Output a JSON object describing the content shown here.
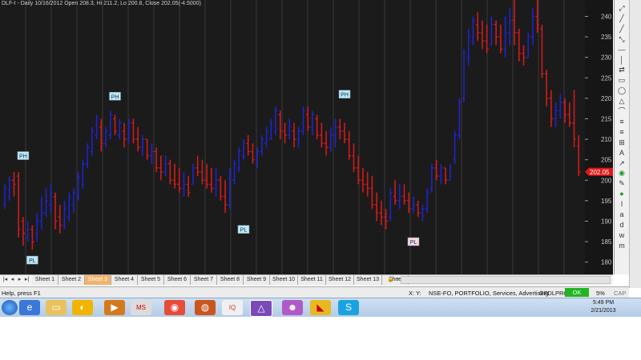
{
  "chart": {
    "title": "DLF-I - Daily 10/16/2012 Open 208.3, Hi 211.2, Lo 200.8, Close 202.05(-4.5000)",
    "last_price_label": "202.05",
    "y_ticks": [
      "240",
      "235",
      "230",
      "225",
      "220",
      "215",
      "210",
      "205",
      "200",
      "195",
      "190",
      "185",
      "180"
    ],
    "annotations": [
      {
        "text": "PH",
        "x": 4,
        "price": 206,
        "kind": "high"
      },
      {
        "text": "PL",
        "x": 6,
        "price": 180.5,
        "kind": "low"
      },
      {
        "text": "PH",
        "x": 24,
        "price": 220.5,
        "kind": "high"
      },
      {
        "text": "PL",
        "x": 52,
        "price": 188,
        "kind": "low"
      },
      {
        "text": "PH",
        "x": 74,
        "price": 221,
        "kind": "high"
      },
      {
        "text": "PL",
        "x": 89,
        "price": 185,
        "kind": "low"
      }
    ],
    "colors": {
      "up": "#1f24c8",
      "down": "#d11a1a",
      "neutral": "#f2e21a",
      "background": "#1b1b1b",
      "grid": "#3a3a3a"
    }
  },
  "chart_data": {
    "type": "ohlc",
    "title": "DLF-I - Daily 10/16/2012 Open 208.3, Hi 211.2, Lo 200.8, Close 202.05(-4.5000)",
    "ylim": [
      177,
      244
    ],
    "grid": true,
    "bars": [
      {
        "h": 199,
        "l": 193,
        "o": 194,
        "c": 198
      },
      {
        "h": 201,
        "l": 195,
        "o": 196,
        "c": 200
      },
      {
        "h": 202,
        "l": 196,
        "o": 200,
        "c": 199
      },
      {
        "h": 202,
        "l": 186,
        "o": 201,
        "c": 188
      },
      {
        "h": 191,
        "l": 184,
        "o": 190,
        "c": 187
      },
      {
        "h": 190,
        "l": 185,
        "o": 186,
        "c": 188
      },
      {
        "h": 189,
        "l": 183,
        "o": 188,
        "c": 185
      },
      {
        "h": 192,
        "l": 185,
        "o": 187,
        "c": 190
      },
      {
        "h": 196,
        "l": 188,
        "o": 190,
        "c": 192
      },
      {
        "h": 198,
        "l": 191,
        "o": 192,
        "c": 195
      },
      {
        "h": 199,
        "l": 192,
        "o": 194,
        "c": 197
      },
      {
        "h": 197,
        "l": 188,
        "o": 196,
        "c": 190
      },
      {
        "h": 194,
        "l": 187,
        "o": 191,
        "c": 189
      },
      {
        "h": 195,
        "l": 188,
        "o": 189,
        "c": 193
      },
      {
        "h": 197,
        "l": 190,
        "o": 191,
        "c": 196
      },
      {
        "h": 198,
        "l": 192,
        "o": 194,
        "c": 197
      },
      {
        "h": 202,
        "l": 195,
        "o": 196,
        "c": 201
      },
      {
        "h": 205,
        "l": 198,
        "o": 199,
        "c": 204
      },
      {
        "h": 209,
        "l": 203,
        "o": 204,
        "c": 208
      },
      {
        "h": 213,
        "l": 206,
        "o": 207,
        "c": 212
      },
      {
        "h": 216,
        "l": 210,
        "o": 211,
        "c": 215
      },
      {
        "h": 215,
        "l": 207,
        "o": 213,
        "c": 209
      },
      {
        "h": 213,
        "l": 208,
        "o": 209,
        "c": 212
      },
      {
        "h": 217,
        "l": 210,
        "o": 211,
        "c": 216
      },
      {
        "h": 216,
        "l": 211,
        "o": 215,
        "c": 212
      },
      {
        "h": 215,
        "l": 210,
        "o": 211,
        "c": 214
      },
      {
        "h": 214,
        "l": 208,
        "o": 212,
        "c": 210
      },
      {
        "h": 215,
        "l": 209,
        "o": 210,
        "c": 214
      },
      {
        "h": 215,
        "l": 209,
        "o": 214,
        "c": 210
      },
      {
        "h": 213,
        "l": 207,
        "o": 210,
        "c": 208
      },
      {
        "h": 211,
        "l": 206,
        "o": 208,
        "c": 210
      },
      {
        "h": 210,
        "l": 205,
        "o": 210,
        "c": 206
      },
      {
        "h": 209,
        "l": 204,
        "o": 206,
        "c": 207
      },
      {
        "h": 208,
        "l": 202,
        "o": 207,
        "c": 203
      },
      {
        "h": 206,
        "l": 200,
        "o": 203,
        "c": 202
      },
      {
        "h": 206,
        "l": 201,
        "o": 202,
        "c": 204
      },
      {
        "h": 205,
        "l": 199,
        "o": 204,
        "c": 200
      },
      {
        "h": 204,
        "l": 198,
        "o": 200,
        "c": 199
      },
      {
        "h": 203,
        "l": 197,
        "o": 199,
        "c": 198
      },
      {
        "h": 202,
        "l": 196,
        "o": 198,
        "c": 199
      },
      {
        "h": 201,
        "l": 196,
        "o": 199,
        "c": 197
      },
      {
        "h": 204,
        "l": 199,
        "o": 199,
        "c": 203
      },
      {
        "h": 206,
        "l": 201,
        "o": 203,
        "c": 202
      },
      {
        "h": 205,
        "l": 199,
        "o": 202,
        "c": 200
      },
      {
        "h": 204,
        "l": 198,
        "o": 200,
        "c": 199
      },
      {
        "h": 203,
        "l": 197,
        "o": 199,
        "c": 198
      },
      {
        "h": 203,
        "l": 196,
        "o": 198,
        "c": 200
      },
      {
        "h": 201,
        "l": 195,
        "o": 200,
        "c": 196
      },
      {
        "h": 200,
        "l": 192,
        "o": 196,
        "c": 194
      },
      {
        "h": 203,
        "l": 193,
        "o": 194,
        "c": 202
      },
      {
        "h": 205,
        "l": 199,
        "o": 200,
        "c": 204
      },
      {
        "h": 208,
        "l": 202,
        "o": 203,
        "c": 207
      },
      {
        "h": 210,
        "l": 205,
        "o": 206,
        "c": 209
      },
      {
        "h": 211,
        "l": 206,
        "o": 209,
        "c": 207
      },
      {
        "h": 209,
        "l": 204,
        "o": 207,
        "c": 205
      },
      {
        "h": 208,
        "l": 203,
        "o": 204,
        "c": 207
      },
      {
        "h": 211,
        "l": 206,
        "o": 207,
        "c": 210
      },
      {
        "h": 213,
        "l": 208,
        "o": 209,
        "c": 212
      },
      {
        "h": 215,
        "l": 210,
        "o": 210,
        "c": 214
      },
      {
        "h": 218,
        "l": 211,
        "o": 212,
        "c": 217
      },
      {
        "h": 217,
        "l": 210,
        "o": 216,
        "c": 212
      },
      {
        "h": 214,
        "l": 209,
        "o": 212,
        "c": 211
      },
      {
        "h": 215,
        "l": 210,
        "o": 211,
        "c": 213
      },
      {
        "h": 214,
        "l": 208,
        "o": 212,
        "c": 210
      },
      {
        "h": 213,
        "l": 208,
        "o": 210,
        "c": 212
      },
      {
        "h": 218,
        "l": 211,
        "o": 212,
        "c": 217
      },
      {
        "h": 218,
        "l": 212,
        "o": 216,
        "c": 213
      },
      {
        "h": 217,
        "l": 211,
        "o": 213,
        "c": 216
      },
      {
        "h": 216,
        "l": 210,
        "o": 215,
        "c": 211
      },
      {
        "h": 214,
        "l": 208,
        "o": 211,
        "c": 209
      },
      {
        "h": 212,
        "l": 206,
        "o": 209,
        "c": 208
      },
      {
        "h": 213,
        "l": 207,
        "o": 208,
        "c": 211
      },
      {
        "h": 215,
        "l": 208,
        "o": 211,
        "c": 213
      },
      {
        "h": 215,
        "l": 210,
        "o": 213,
        "c": 212
      },
      {
        "h": 214,
        "l": 209,
        "o": 212,
        "c": 210
      },
      {
        "h": 212,
        "l": 205,
        "o": 210,
        "c": 206
      },
      {
        "h": 209,
        "l": 202,
        "o": 206,
        "c": 203
      },
      {
        "h": 206,
        "l": 199,
        "o": 203,
        "c": 200
      },
      {
        "h": 203,
        "l": 197,
        "o": 200,
        "c": 199
      },
      {
        "h": 202,
        "l": 196,
        "o": 199,
        "c": 198
      },
      {
        "h": 201,
        "l": 193,
        "o": 198,
        "c": 194
      },
      {
        "h": 197,
        "l": 190,
        "o": 194,
        "c": 192
      },
      {
        "h": 195,
        "l": 189,
        "o": 192,
        "c": 191
      },
      {
        "h": 193,
        "l": 188,
        "o": 191,
        "c": 190
      },
      {
        "h": 198,
        "l": 190,
        "o": 191,
        "c": 197
      },
      {
        "h": 200,
        "l": 194,
        "o": 196,
        "c": 195
      },
      {
        "h": 199,
        "l": 193,
        "o": 195,
        "c": 196
      },
      {
        "h": 199,
        "l": 194,
        "o": 196,
        "c": 195
      },
      {
        "h": 197,
        "l": 192,
        "o": 195,
        "c": 193
      },
      {
        "h": 196,
        "l": 192,
        "o": 193,
        "c": 194
      },
      {
        "h": 195,
        "l": 191,
        "o": 194,
        "c": 192
      },
      {
        "h": 194,
        "l": 190,
        "o": 192,
        "c": 193
      },
      {
        "h": 198,
        "l": 192,
        "o": 193,
        "c": 197
      },
      {
        "h": 204,
        "l": 197,
        "o": 198,
        "c": 203
      },
      {
        "h": 205,
        "l": 200,
        "o": 203,
        "c": 201
      },
      {
        "h": 204,
        "l": 199,
        "o": 201,
        "c": 203
      },
      {
        "h": 203,
        "l": 199,
        "o": 203,
        "c": 200
      },
      {
        "h": 204,
        "l": 200,
        "o": 200,
        "c": 203
      },
      {
        "h": 212,
        "l": 204,
        "o": 205,
        "c": 211
      },
      {
        "h": 220,
        "l": 210,
        "o": 211,
        "c": 219
      },
      {
        "h": 232,
        "l": 219,
        "o": 220,
        "c": 231
      },
      {
        "h": 237,
        "l": 228,
        "o": 230,
        "c": 235
      },
      {
        "h": 240,
        "l": 233,
        "o": 234,
        "c": 239
      },
      {
        "h": 241,
        "l": 234,
        "o": 238,
        "c": 236
      },
      {
        "h": 239,
        "l": 232,
        "o": 236,
        "c": 234
      },
      {
        "h": 238,
        "l": 231,
        "o": 234,
        "c": 232
      },
      {
        "h": 240,
        "l": 233,
        "o": 233,
        "c": 238
      },
      {
        "h": 239,
        "l": 233,
        "o": 238,
        "c": 235
      },
      {
        "h": 238,
        "l": 231,
        "o": 235,
        "c": 232
      },
      {
        "h": 240,
        "l": 230,
        "o": 232,
        "c": 236
      },
      {
        "h": 242,
        "l": 233,
        "o": 236,
        "c": 239
      },
      {
        "h": 244,
        "l": 233,
        "o": 239,
        "c": 236
      },
      {
        "h": 237,
        "l": 229,
        "o": 236,
        "c": 231
      },
      {
        "h": 233,
        "l": 228,
        "o": 231,
        "c": 230
      },
      {
        "h": 236,
        "l": 230,
        "o": 230,
        "c": 235
      },
      {
        "h": 242,
        "l": 233,
        "o": 235,
        "c": 240
      },
      {
        "h": 244,
        "l": 236,
        "o": 240,
        "c": 238
      },
      {
        "h": 238,
        "l": 225,
        "o": 237,
        "c": 226
      },
      {
        "h": 227,
        "l": 218,
        "o": 226,
        "c": 220
      },
      {
        "h": 222,
        "l": 213,
        "o": 220,
        "c": 215
      },
      {
        "h": 219,
        "l": 213,
        "o": 215,
        "c": 217
      },
      {
        "h": 221,
        "l": 215,
        "o": 217,
        "c": 219
      },
      {
        "h": 220,
        "l": 214,
        "o": 219,
        "c": 216
      },
      {
        "h": 219,
        "l": 213,
        "o": 216,
        "c": 214
      },
      {
        "h": 222,
        "l": 208,
        "o": 214,
        "c": 210
      },
      {
        "h": 211,
        "l": 201,
        "o": 208.3,
        "c": 202.05
      }
    ]
  },
  "toolbar": {
    "tools": [
      "cursor",
      "line",
      "ray",
      "ext-line",
      "horiz-line",
      "vert-line",
      "arrow",
      "rect",
      "ellipse",
      "triangle",
      "arc",
      "fib",
      "fib-ext",
      "gann",
      "text",
      "line-ext",
      "zoom",
      "pen",
      "color",
      "info",
      "a-tool",
      "d-tool",
      "p-tool",
      "m-tool"
    ],
    "tool_glyphs": [
      "⤢",
      "╱",
      "╱",
      "⤡",
      "—",
      "│",
      "⇄",
      "▭",
      "◯",
      "△",
      "⌒",
      "≡",
      "≡",
      "⊞",
      "A",
      "↗",
      "◉",
      "✎",
      "●",
      "ǀ",
      "a",
      "d",
      "w",
      "m"
    ]
  },
  "sheets": {
    "tabs": [
      "Sheet 1",
      "Sheet 2",
      "Sheet 3",
      "Sheet 4",
      "Sheet 5",
      "Sheet 6",
      "Sheet 7",
      "Sheet 8",
      "Sheet 9",
      "Sheet 10",
      "Sheet 11",
      "Sheet 12",
      "Sheet 13",
      "Shee"
    ],
    "active_index": 2
  },
  "status": {
    "help": "Help, press F1",
    "coords": "X:    Y:",
    "db": "NSE-FO, PORTFOLIO, Services, Advertising",
    "server": "GFDLPRO",
    "ok": "OK",
    "percent": "5%",
    "cap": "CAP"
  },
  "taskbar": {
    "apps": [
      "start",
      "ie",
      "explorer",
      "app-round",
      "media",
      "ms-app",
      "chrome",
      "app-fire",
      "app-iq",
      "amibroker",
      "app-purple",
      "app-flag",
      "skype"
    ],
    "time": "5:49 PM",
    "date": "2/21/2013"
  }
}
